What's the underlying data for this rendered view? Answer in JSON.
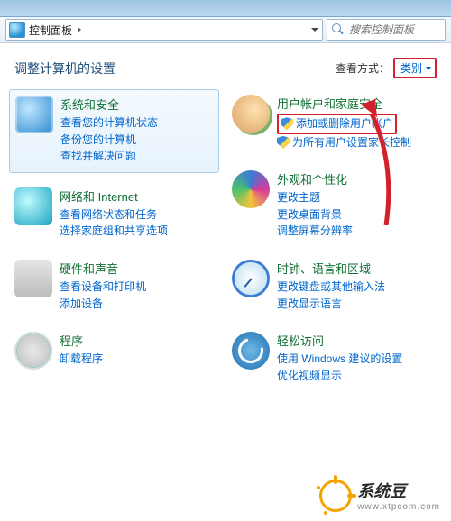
{
  "window": {
    "address_label": "控制面板",
    "search_placeholder": "搜索控制面板"
  },
  "header": {
    "page_title": "调整计算机的设置",
    "view_label": "查看方式：",
    "view_value": "类别"
  },
  "left_categories": [
    {
      "title": "系统和安全",
      "icon": "security",
      "links": [
        {
          "label": "查看您的计算机状态",
          "shield": false
        },
        {
          "label": "备份您的计算机",
          "shield": false
        },
        {
          "label": "查找并解决问题",
          "shield": false
        }
      ],
      "selected": true
    },
    {
      "title": "网络和 Internet",
      "icon": "network",
      "links": [
        {
          "label": "查看网络状态和任务",
          "shield": false
        },
        {
          "label": "选择家庭组和共享选项",
          "shield": false
        }
      ]
    },
    {
      "title": "硬件和声音",
      "icon": "hardware",
      "links": [
        {
          "label": "查看设备和打印机",
          "shield": false
        },
        {
          "label": "添加设备",
          "shield": false
        }
      ]
    },
    {
      "title": "程序",
      "icon": "programs",
      "links": [
        {
          "label": "卸载程序",
          "shield": false
        }
      ]
    }
  ],
  "right_categories": [
    {
      "title": "用户帐户和家庭安全",
      "icon": "users",
      "links": [
        {
          "label": "添加或删除用户帐户",
          "shield": true,
          "highlight": true
        },
        {
          "label": "为所有用户设置家长控制",
          "shield": true
        }
      ]
    },
    {
      "title": "外观和个性化",
      "icon": "appearance",
      "links": [
        {
          "label": "更改主题",
          "shield": false
        },
        {
          "label": "更改桌面背景",
          "shield": false
        },
        {
          "label": "调整屏幕分辨率",
          "shield": false
        }
      ]
    },
    {
      "title": "时钟、语言和区域",
      "icon": "clock",
      "links": [
        {
          "label": "更改键盘或其他输入法",
          "shield": false
        },
        {
          "label": "更改显示语言",
          "shield": false
        }
      ]
    },
    {
      "title": "轻松访问",
      "icon": "access",
      "links": [
        {
          "label": "使用 Windows 建议的设置",
          "shield": false
        },
        {
          "label": "优化视频显示",
          "shield": false
        }
      ]
    }
  ],
  "brand": {
    "name": "系统豆",
    "url": "www.xtpcom.com"
  },
  "annotation": {
    "arrow_target": "添加或删除用户帐户"
  }
}
